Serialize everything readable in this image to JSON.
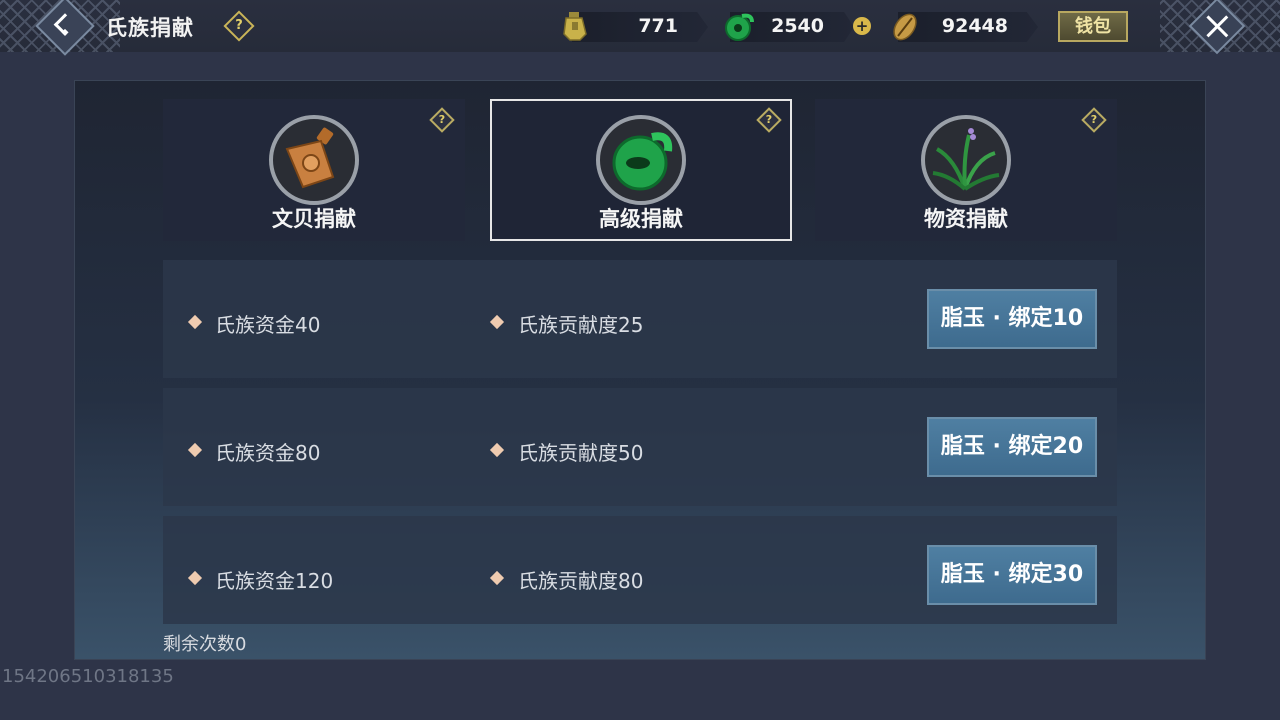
{
  "header": {
    "title": "氏族捐献",
    "help_icon": "?",
    "wallet_label": "钱包",
    "currencies": [
      {
        "name": "copper-coin-icon",
        "value": "771"
      },
      {
        "name": "jade-icon",
        "value": "2540"
      },
      {
        "name": "shell-icon",
        "value": "92448"
      }
    ],
    "plus_icon": "+"
  },
  "tabs": [
    {
      "label": "文贝捐献",
      "icon": "copper-coin-icon",
      "help": "?"
    },
    {
      "label": "高级捐献",
      "icon": "jade-icon",
      "help": "?"
    },
    {
      "label": "物资捐献",
      "icon": "herb-icon",
      "help": "?"
    }
  ],
  "rows": [
    {
      "fund": "氏族资金40",
      "contribution": "氏族贡献度25",
      "button": "脂玉 · 绑定10"
    },
    {
      "fund": "氏族资金80",
      "contribution": "氏族贡献度50",
      "button": "脂玉 · 绑定20"
    },
    {
      "fund": "氏族资金120",
      "contribution": "氏族贡献度80",
      "button": "脂玉 · 绑定30"
    }
  ],
  "remaining": "剩余次数0",
  "uid": "154206510318135",
  "colors": {
    "accent_gold": "#d9b84a",
    "button_blue": "#4a7899",
    "jade_green": "#1fa34a",
    "bullet": "#efcbb0"
  }
}
